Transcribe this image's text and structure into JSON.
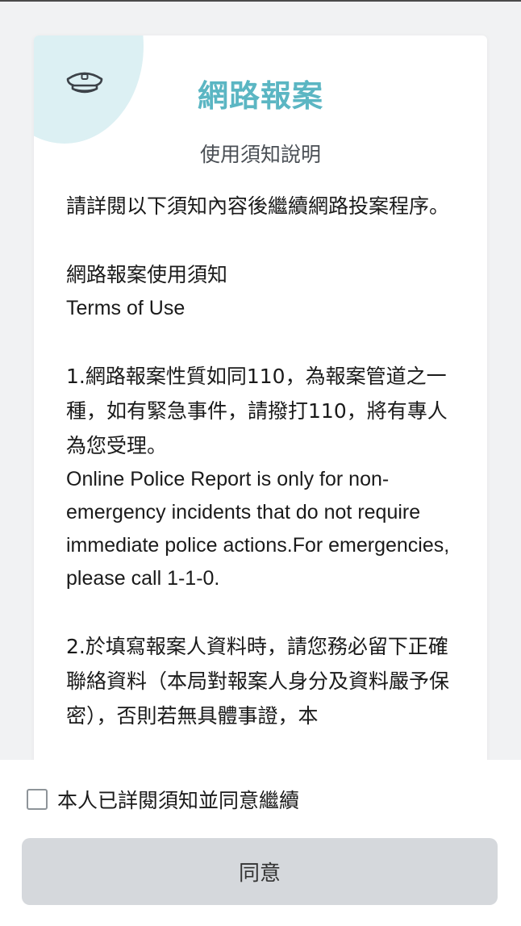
{
  "header": {
    "title": "網路報案",
    "subtitle": "使用須知說明",
    "icon": "police-cap-icon"
  },
  "content": {
    "intro": "請詳閱以下須知內容後繼續網路投案程序。",
    "terms_heading_zh": "網路報案使用須知",
    "terms_heading_en": "Terms of Use",
    "item1_zh": "1.網路報案性質如同110，為報案管道之一種，如有緊急事件，請撥打110，將有專人為您受理。",
    "item1_en": "Online Police Report is only for non-emergency incidents that do not require immediate police actions.For emergencies, please call 1-1-0.",
    "item2_zh": "2.於填寫報案人資料時，請您務必留下正確聯絡資料（本局對報案人身分及資料嚴予保密），否則若無具體事證，本"
  },
  "footer": {
    "agree_checkbox_label": "本人已詳閱須知並同意繼續",
    "agree_checked": false,
    "agree_button_label": "同意"
  },
  "colors": {
    "accent": "#5bb6c3",
    "deco_circle": "#dcf0f3",
    "button_bg": "#d5d8dc",
    "page_bg": "#f1f2f3"
  }
}
